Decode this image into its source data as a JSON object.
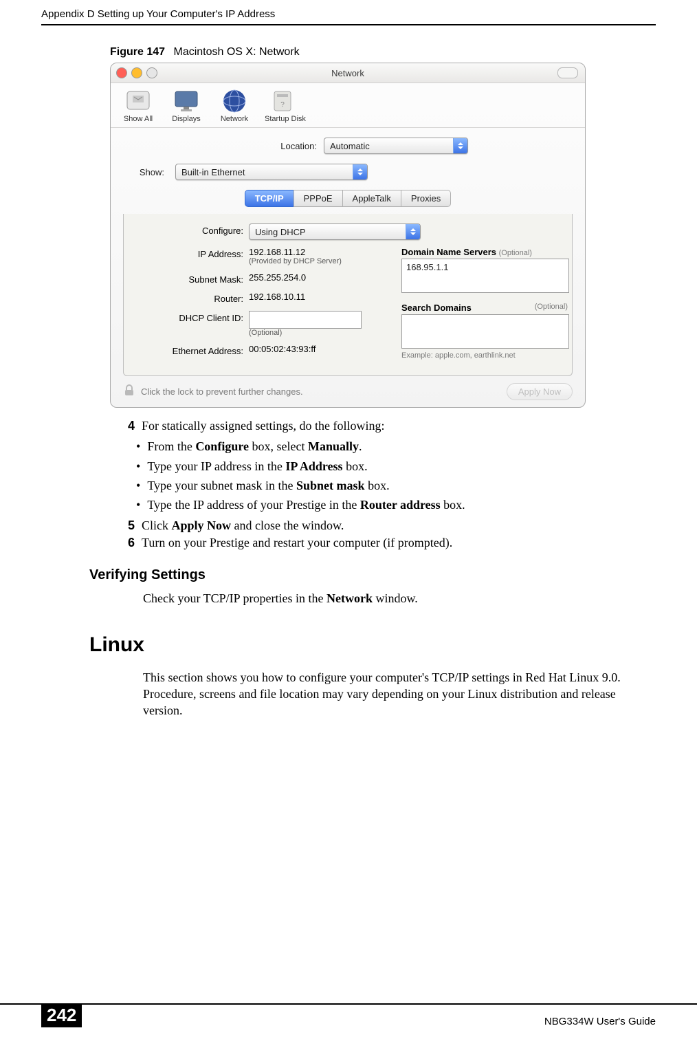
{
  "running_head": "Appendix D Setting up Your Computer's IP Address",
  "figure": {
    "label": "Figure 147",
    "title": "Macintosh OS X: Network"
  },
  "mac": {
    "window_title": "Network",
    "toolbar": {
      "show_all": "Show All",
      "displays": "Displays",
      "network": "Network",
      "startup_disk": "Startup Disk"
    },
    "location_label": "Location:",
    "location_value": "Automatic",
    "show_label": "Show:",
    "show_value": "Built-in Ethernet",
    "tabs": {
      "tcpip": "TCP/IP",
      "pppoe": "PPPoE",
      "appletalk": "AppleTalk",
      "proxies": "Proxies"
    },
    "configure_label": "Configure:",
    "configure_value": "Using DHCP",
    "dns_header": "Domain Name Servers",
    "optional": "(Optional)",
    "dns_value": "168.95.1.1",
    "ip_label": "IP Address:",
    "ip_value": "192.168.11.12",
    "ip_sub": "(Provided by DHCP Server)",
    "mask_label": "Subnet Mask:",
    "mask_value": "255.255.254.0",
    "router_label": "Router:",
    "router_value": "192.168.10.11",
    "search_header": "Search Domains",
    "dhcp_id_label": "DHCP Client ID:",
    "dhcp_id_sub": "(Optional)",
    "eth_label": "Ethernet Address:",
    "eth_value": "00:05:02:43:93:ff",
    "example_text": "Example: apple.com, earthlink.net",
    "lock_text": "Click the lock to prevent further changes.",
    "apply_btn": "Apply Now"
  },
  "steps": {
    "s4": "For statically assigned settings, do the following:",
    "s4b1_pre": "From the ",
    "s4b1_bold": "Configure",
    "s4b1_mid": " box, select ",
    "s4b1_bold2": "Manually",
    "s4b1_post": ".",
    "s4b2_pre": "Type your IP address in the ",
    "s4b2_bold": "IP Address",
    "s4b2_post": " box.",
    "s4b3_pre": "Type your subnet mask in the ",
    "s4b3_bold": "Subnet mask",
    "s4b3_post": " box.",
    "s4b4_pre": "Type the IP address of your Prestige in the ",
    "s4b4_bold": "Router address",
    "s4b4_post": " box.",
    "s5_pre": "Click ",
    "s5_bold": "Apply Now",
    "s5_post": " and close the window.",
    "s6": "Turn on your Prestige and restart your computer (if prompted)."
  },
  "verifying": {
    "head": "Verifying Settings",
    "text_pre": "Check your TCP/IP properties in the ",
    "text_bold": "Network",
    "text_post": " window."
  },
  "linux": {
    "head": "Linux",
    "para": "This section shows you how to configure your computer's TCP/IP settings in Red Hat Linux 9.0. Procedure, screens and file location may vary depending on your Linux distribution and release version."
  },
  "footer": {
    "page": "242",
    "guide": "NBG334W User's Guide"
  }
}
